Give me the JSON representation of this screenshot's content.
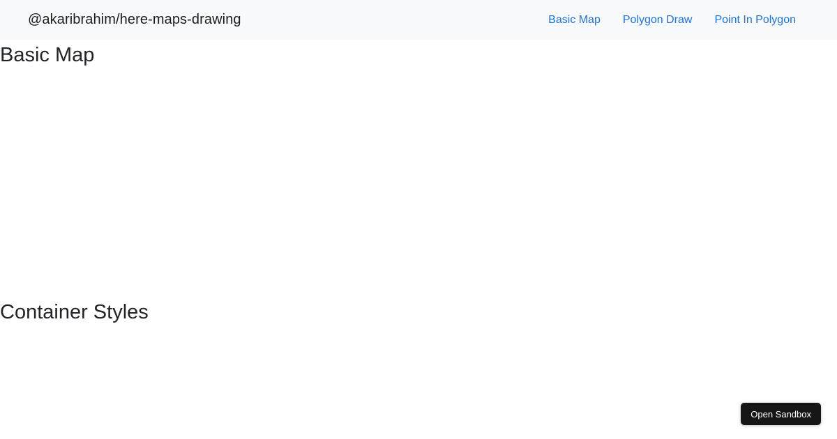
{
  "navbar": {
    "brand": "@akaribrahim/here-maps-drawing",
    "links": [
      {
        "label": "Basic Map"
      },
      {
        "label": "Polygon Draw"
      },
      {
        "label": "Point In Polygon"
      }
    ]
  },
  "sections": [
    {
      "heading": "Basic Map"
    },
    {
      "heading": "Container Styles"
    }
  ],
  "overlay": {
    "open_sandbox_label": "Open Sandbox"
  },
  "colors": {
    "page_bg": "#ffffff",
    "navbar_bg": "#f8f9fa",
    "brand_text": "#1c1c1c",
    "link_blue": "#1a73e8",
    "heading_text": "#212529",
    "button_bg": "#161616",
    "button_text": "#ffffff"
  }
}
